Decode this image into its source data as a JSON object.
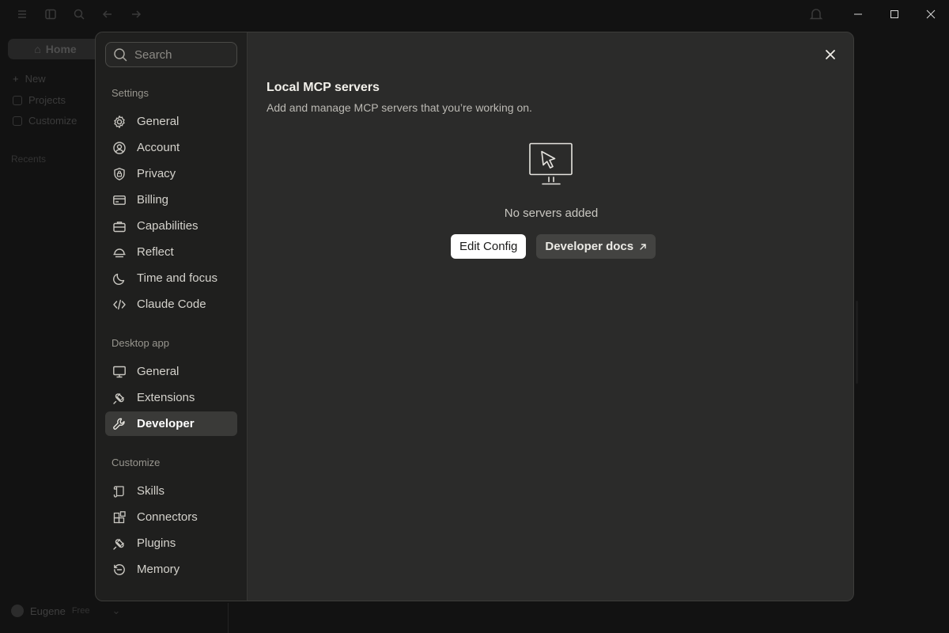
{
  "background": {
    "home_label": "Home",
    "nav": [
      {
        "label": "New",
        "icon": "plus-icon"
      },
      {
        "label": "Projects",
        "icon": "folder-icon"
      },
      {
        "label": "Customize",
        "icon": "briefcase-icon"
      }
    ],
    "recents_label": "Recents",
    "user_name": "Eugene",
    "user_plan": "Free"
  },
  "search": {
    "placeholder": "Search"
  },
  "sidebar": {
    "settings_label": "Settings",
    "settings_items": [
      {
        "label": "General",
        "icon": "gear-icon"
      },
      {
        "label": "Account",
        "icon": "user-circle-icon"
      },
      {
        "label": "Privacy",
        "icon": "shield-lock-icon"
      },
      {
        "label": "Billing",
        "icon": "credit-card-icon"
      },
      {
        "label": "Capabilities",
        "icon": "briefcase-icon"
      },
      {
        "label": "Reflect",
        "icon": "sunset-icon"
      },
      {
        "label": "Time and focus",
        "icon": "moon-icon"
      },
      {
        "label": "Claude Code",
        "icon": "code-icon"
      }
    ],
    "desktop_label": "Desktop app",
    "desktop_items": [
      {
        "label": "General",
        "icon": "monitor-icon"
      },
      {
        "label": "Extensions",
        "icon": "plug-icon"
      },
      {
        "label": "Developer",
        "icon": "wrench-icon",
        "active": true
      }
    ],
    "customize_label": "Customize",
    "customize_items": [
      {
        "label": "Skills",
        "icon": "scroll-icon"
      },
      {
        "label": "Connectors",
        "icon": "blocks-icon"
      },
      {
        "label": "Plugins",
        "icon": "plug-icon"
      },
      {
        "label": "Memory",
        "icon": "history-icon"
      }
    ]
  },
  "main": {
    "title": "Local MCP servers",
    "subtitle": "Add and manage MCP servers that you’re working on.",
    "empty_state": "No servers added",
    "edit_config_label": "Edit Config",
    "developer_docs_label": "Developer docs"
  },
  "colors": {
    "modal_bg": "#2b2b2a",
    "sidebar_bg": "#1f1f1e",
    "active_item_bg": "#3a3a38",
    "primary_button_bg": "#ffffff",
    "secondary_button_bg": "#434341"
  }
}
